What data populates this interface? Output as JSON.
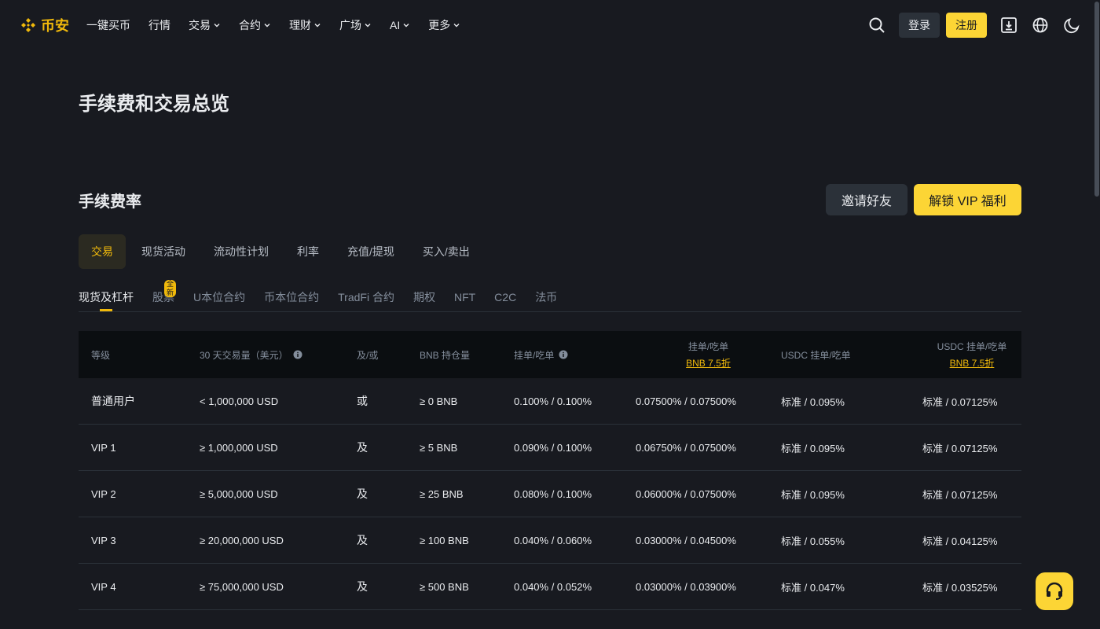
{
  "brand": {
    "name": "币安",
    "color": "#f0b90b"
  },
  "nav": [
    {
      "label": "一键买币",
      "has_dropdown": false
    },
    {
      "label": "行情",
      "has_dropdown": false
    },
    {
      "label": "交易",
      "has_dropdown": true
    },
    {
      "label": "合约",
      "has_dropdown": true
    },
    {
      "label": "理财",
      "has_dropdown": true
    },
    {
      "label": "广场",
      "has_dropdown": true
    },
    {
      "label": "AI",
      "has_dropdown": true
    },
    {
      "label": "更多",
      "has_dropdown": true
    }
  ],
  "header": {
    "login_label": "登录",
    "register_label": "注册",
    "icons": [
      "search-icon",
      "download-icon",
      "globe-icon",
      "moon-icon"
    ]
  },
  "page": {
    "title": "手续费和交易总览",
    "section_title": "手续费率",
    "invite_label": "邀请好友",
    "vip_label": "解锁 VIP 福利"
  },
  "main_tabs": [
    "交易",
    "现货活动",
    "流动性计划",
    "利率",
    "充值/提现",
    "买入/卖出"
  ],
  "sub_tabs": [
    "现货及杠杆",
    "股票",
    "U本位合约",
    "币本位合约",
    "TradFi 合约",
    "期权",
    "NFT",
    "C2C",
    "法币"
  ],
  "sub_tab_badge": "全新",
  "table": {
    "headers": {
      "level": "等级",
      "volume": "30 天交易量（美元）",
      "andor": "及/或",
      "bnb": "BNB 持仓量",
      "maker_taker": "挂单/吃单",
      "bnb_maker_taker": "挂单/吃单",
      "bnb_discount": "BNB 7.5折",
      "usdc": "USDC 挂单/吃单",
      "usdc_bnb": "USDC 挂单/吃单",
      "usdc_bnb_discount": "BNB 7.5折"
    },
    "rows": [
      {
        "level": "普通用户",
        "volume": "< 1,000,000 USD",
        "andor": "或",
        "bnb": "≥ 0 BNB",
        "mt": "0.100% / 0.100%",
        "bnb_mt": "0.07500% / 0.07500%",
        "usdc": "标准 / 0.095%",
        "usdc_bnb": "标准 / 0.07125%"
      },
      {
        "level": "VIP 1",
        "volume": "≥ 1,000,000 USD",
        "andor": "及",
        "bnb": "≥ 5 BNB",
        "mt": "0.090% / 0.100%",
        "bnb_mt": "0.06750% / 0.07500%",
        "usdc": "标准 / 0.095%",
        "usdc_bnb": "标准 / 0.07125%"
      },
      {
        "level": "VIP 2",
        "volume": "≥ 5,000,000 USD",
        "andor": "及",
        "bnb": "≥ 25 BNB",
        "mt": "0.080% / 0.100%",
        "bnb_mt": "0.06000% / 0.07500%",
        "usdc": "标准 / 0.095%",
        "usdc_bnb": "标准 / 0.07125%"
      },
      {
        "level": "VIP 3",
        "volume": "≥ 20,000,000 USD",
        "andor": "及",
        "bnb": "≥ 100 BNB",
        "mt": "0.040% / 0.060%",
        "bnb_mt": "0.03000% / 0.04500%",
        "usdc": "标准 / 0.055%",
        "usdc_bnb": "标准 / 0.04125%"
      },
      {
        "level": "VIP 4",
        "volume": "≥ 75,000,000 USD",
        "andor": "及",
        "bnb": "≥ 500 BNB",
        "mt": "0.040% / 0.052%",
        "bnb_mt": "0.03000% / 0.03900%",
        "usdc": "标准 / 0.047%",
        "usdc_bnb": "标准 / 0.03525%"
      }
    ]
  },
  "colors": {
    "background": "#181a20",
    "accent": "#fcd535",
    "muted_text": "#848e9c",
    "panel": "#2b3139"
  }
}
